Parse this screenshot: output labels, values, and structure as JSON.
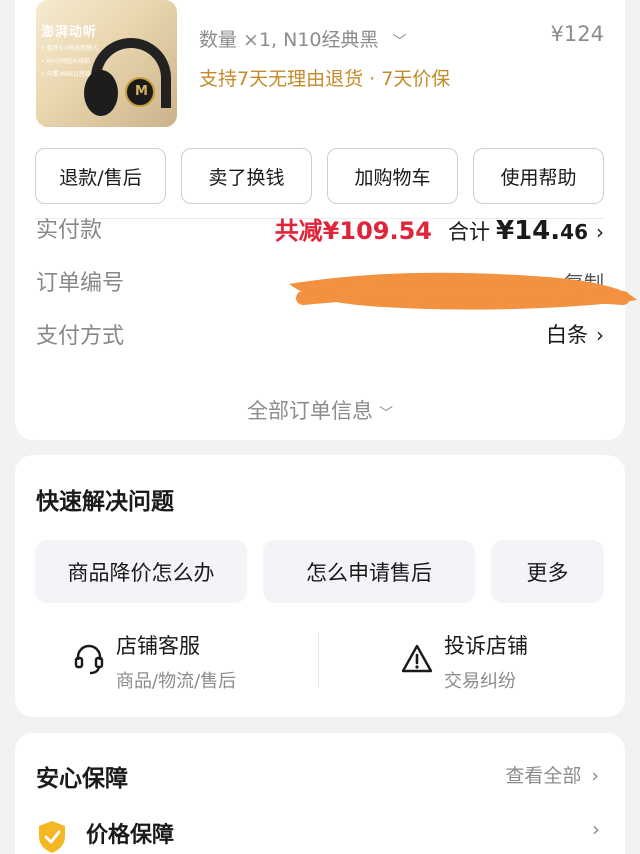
{
  "product": {
    "thumb_title": "澎湃动听",
    "thumb_features": [
      "• 蓝牙6.0有线双模式",
      "• 60小时超长续航",
      "• 内置399EQ音效"
    ],
    "thumb_logo": "M",
    "spec": "数量 ×1, N10经典黑",
    "price": "¥124",
    "policy": "支持7天无理由退货 · 7天价保"
  },
  "actions": [
    "退款/售后",
    "卖了换钱",
    "加购物车",
    "使用帮助"
  ],
  "payment": {
    "label": "实付款",
    "discount": "共减¥109.54",
    "total_label": "合计",
    "total_currency": "¥",
    "total_int": "14.",
    "total_dec": "46"
  },
  "order": {
    "label": "订单编号",
    "copy": "复制"
  },
  "pay_method": {
    "label": "支付方式",
    "value": "白条"
  },
  "all_info": "全部订单信息",
  "quick": {
    "title": "快速解决问题",
    "chips": [
      "商品降价怎么办",
      "怎么申请售后",
      "更多"
    ],
    "service": {
      "title": "店铺客服",
      "sub": "商品/物流/售后"
    },
    "complaint": {
      "title": "投诉店铺",
      "sub": "交易纠纷"
    }
  },
  "assurance": {
    "title": "安心保障",
    "view_all": "查看全部",
    "item": "价格保障"
  },
  "colors": {
    "accent_red": "#e0243a",
    "policy_gold": "#c48a2a",
    "redaction": "#f2913f"
  }
}
